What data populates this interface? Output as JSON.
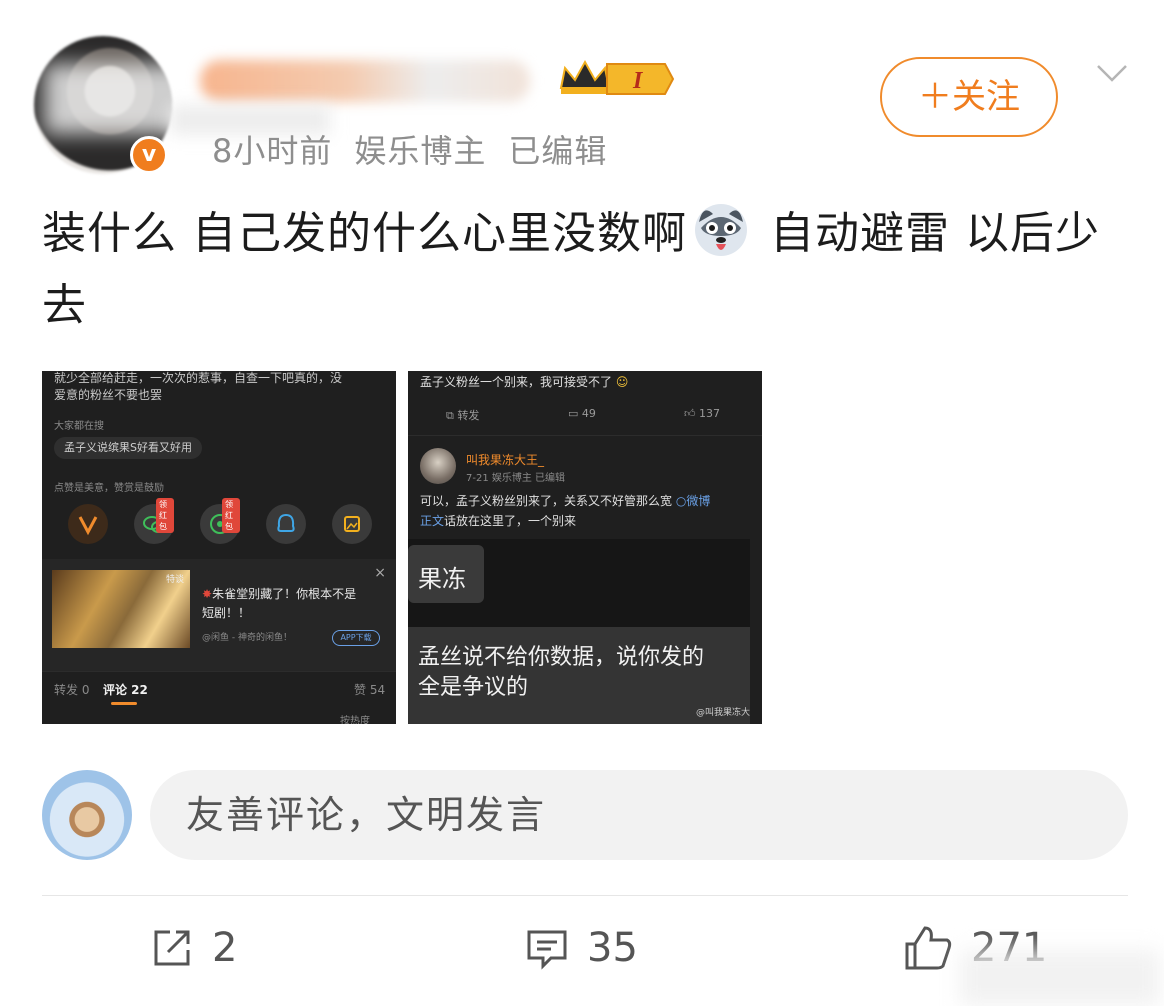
{
  "post": {
    "author": {
      "time": "8小时前",
      "role": "娱乐博主",
      "edited": "已编辑",
      "verified_badge": "v",
      "member_level": "I"
    },
    "follow_label": "＋关注",
    "text_part1": "装什么 自己发的什么心里没数啊",
    "text_part2": " 自动避雷 以后少去",
    "emoji_name": "husky-emoji"
  },
  "screenshot_a": {
    "line1": "就少全部给赶走，一次次的惹事，自查一下吧真的，没",
    "line2": "爱意的粉丝不要也罢",
    "search_heading": "大家都在搜",
    "search_pill": "孟子义说缤果S好看又好用",
    "like_hint": "点赞是美意，赞赏是鼓励",
    "red_tag1": "领红包",
    "red_tag2": "领红包",
    "ad_tag": "特谈",
    "ad_title_1": "朱雀堂别藏了！你根本不是",
    "ad_title_2": "短剧！！",
    "ad_source": "@闲鱼 - 神奇的闲鱼！",
    "ad_button": "APP下载",
    "close_glyph": "×",
    "tab_repost": "转发 0",
    "tab_comment": "评论 22",
    "tab_like": "赞 54",
    "sort_label": "按热度"
  },
  "screenshot_b": {
    "top_line": "孟子义粉丝一个别来，我可接受不了",
    "repost": "转发",
    "comments": "49",
    "likes": "137",
    "user": "叫我果冻大王_",
    "meta": "7-21  娱乐博主  已编辑",
    "body1": "可以，孟子义粉丝别来了，关系又不好管那么宽",
    "link": "微博",
    "body2a": "正文",
    "body2b": "话放在这里了，一个别来",
    "chat1": "果冻",
    "chat2_line1": "孟丝说不给你数据，说你发的",
    "chat2_line2": "全是争议的",
    "watermark": "@叫我果冻大"
  },
  "comment_input": {
    "placeholder": "友善评论，文明发言"
  },
  "actions": {
    "share_count": "2",
    "comment_count": "35",
    "like_count": "271"
  },
  "colors": {
    "accent": "#f07d1e",
    "text": "#1c1c1c",
    "muted": "#8e8e8e",
    "input_bg": "#f2f2f2"
  }
}
